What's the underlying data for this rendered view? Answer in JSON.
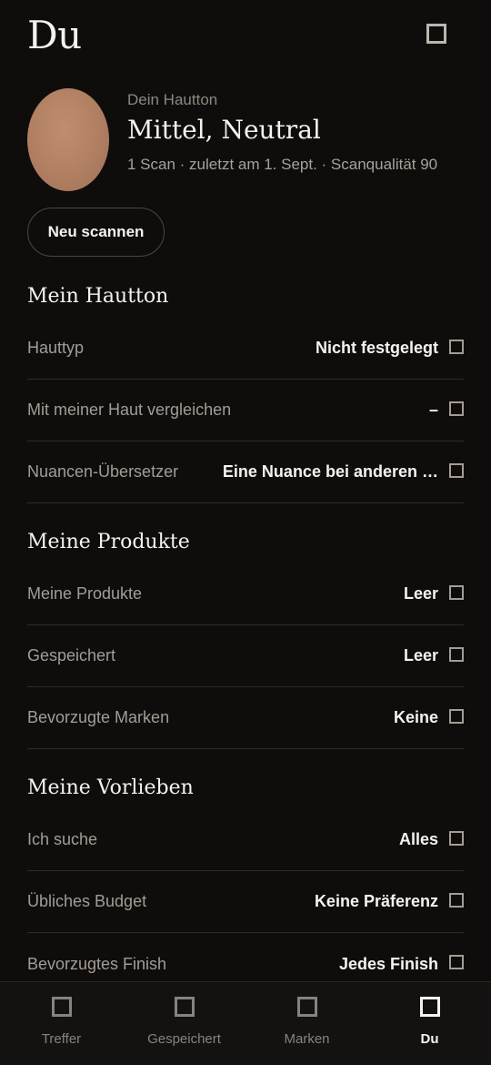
{
  "header": {
    "title": "Du",
    "settings_icon": "settings-icon"
  },
  "profile": {
    "tone_label": "Dein Hautton",
    "tone_value": "Mittel, Neutral",
    "meta": "1 Scan · zuletzt am 1. Sept. · Scanqualität 90",
    "swatch_color": "#b5856a",
    "rescan_label": "Neu scannen"
  },
  "sections": {
    "hautton": {
      "title": "Mein Hautton",
      "rows": [
        {
          "label": "Hauttyp",
          "value": "Nicht festgelegt"
        },
        {
          "label": "Mit meiner Haut vergleichen",
          "value": "–"
        },
        {
          "label": "Nuancen-Übersetzer",
          "value": "Eine Nuance bei anderen …"
        }
      ]
    },
    "produkte": {
      "title": "Meine Produkte",
      "rows": [
        {
          "label": "Meine Produkte",
          "value": "Leer"
        },
        {
          "label": "Gespeichert",
          "value": "Leer"
        },
        {
          "label": "Bevorzugte Marken",
          "value": "Keine"
        }
      ]
    },
    "vorlieben": {
      "title": "Meine Vorlieben",
      "rows": [
        {
          "label": "Ich suche",
          "value": "Alles"
        },
        {
          "label": "Übliches Budget",
          "value": "Keine Präferenz"
        },
        {
          "label": "Bevorzugtes Finish",
          "value": "Jedes Finish"
        }
      ]
    }
  },
  "tabbar": {
    "tabs": [
      {
        "label": "Treffer",
        "icon": "matches-icon",
        "active": false
      },
      {
        "label": "Gespeichert",
        "icon": "saved-icon",
        "active": false
      },
      {
        "label": "Marken",
        "icon": "brands-icon",
        "active": false
      },
      {
        "label": "Du",
        "icon": "profile-icon",
        "active": true
      }
    ]
  }
}
